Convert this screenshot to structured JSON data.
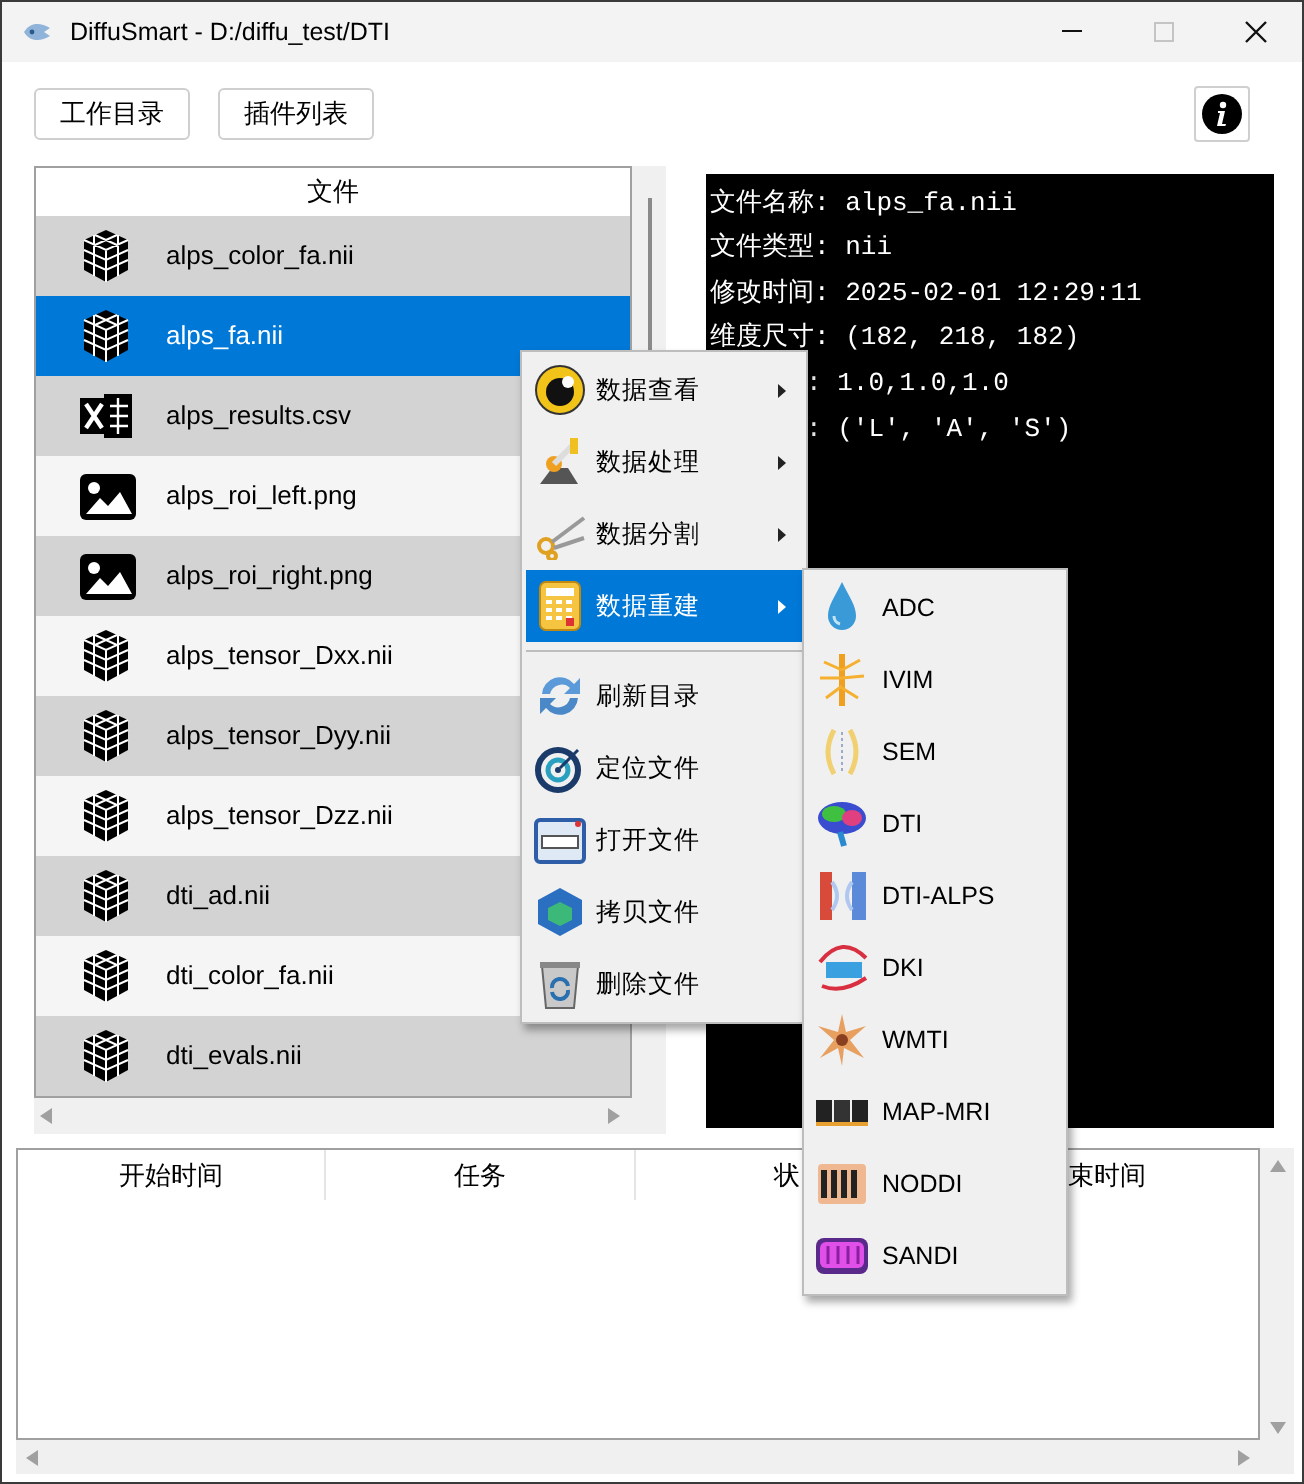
{
  "window": {
    "title": "DiffuSmart - D:/diffu_test/DTI",
    "controls": [
      {
        "kind": "minimize",
        "disabled": false
      },
      {
        "kind": "maximize",
        "disabled": true
      },
      {
        "kind": "close",
        "disabled": false
      }
    ]
  },
  "toolbar": {
    "buttons": [
      "工作目录",
      "插件列表"
    ]
  },
  "file_list": {
    "header": "文件",
    "rows": [
      {
        "name": "alps_color_fa.nii",
        "kind": "volume",
        "selected": false
      },
      {
        "name": "alps_fa.nii",
        "kind": "volume",
        "selected": true
      },
      {
        "name": "alps_results.csv",
        "kind": "spreadsheet",
        "selected": false
      },
      {
        "name": "alps_roi_left.png",
        "kind": "image",
        "selected": false
      },
      {
        "name": "alps_roi_right.png",
        "kind": "image",
        "selected": false
      },
      {
        "name": "alps_tensor_Dxx.nii",
        "kind": "volume",
        "selected": false
      },
      {
        "name": "alps_tensor_Dyy.nii",
        "kind": "volume",
        "selected": false
      },
      {
        "name": "alps_tensor_Dzz.nii",
        "kind": "volume",
        "selected": false
      },
      {
        "name": "dti_ad.nii",
        "kind": "volume",
        "selected": false
      },
      {
        "name": "dti_color_fa.nii",
        "kind": "volume",
        "selected": false
      },
      {
        "name": "dti_evals.nii",
        "kind": "volume",
        "selected": false
      }
    ]
  },
  "file_info": {
    "lines": [
      {
        "text": "文件名称: alps_fa.nii",
        "kind": "full"
      },
      {
        "text": "文件类型: nii",
        "kind": "full"
      },
      {
        "text": "修改时间: 2025-02-01 12:29:11",
        "kind": "full"
      },
      {
        "text": "维度尺寸: (182, 218, 182)",
        "kind": "full"
      },
      {
        "text": ": 1.0,1.0,1.0",
        "kind": "covered"
      },
      {
        "text": ": ('L', 'A', 'S')",
        "kind": "covered"
      }
    ]
  },
  "task_table": {
    "columns": [
      "开始时间",
      "任务",
      "状",
      "束时间"
    ]
  },
  "context_menu": {
    "items": [
      {
        "kind": "item",
        "label": "数据查看",
        "submenu": true,
        "selected": false
      },
      {
        "kind": "item",
        "label": "数据处理",
        "submenu": true,
        "selected": false
      },
      {
        "kind": "item",
        "label": "数据分割",
        "submenu": true,
        "selected": false
      },
      {
        "kind": "item",
        "label": "数据重建",
        "submenu": true,
        "selected": true
      },
      {
        "kind": "separator"
      },
      {
        "kind": "item",
        "label": "刷新目录",
        "submenu": false,
        "selected": false
      },
      {
        "kind": "item",
        "label": "定位文件",
        "submenu": false,
        "selected": false
      },
      {
        "kind": "item",
        "label": "打开文件",
        "submenu": false,
        "selected": false
      },
      {
        "kind": "item",
        "label": "拷贝文件",
        "submenu": false,
        "selected": false
      },
      {
        "kind": "item",
        "label": "删除文件",
        "submenu": false,
        "selected": false
      }
    ]
  },
  "submenu": {
    "items": [
      "ADC",
      "IVIM",
      "SEM",
      "DTI",
      "DTI-ALPS",
      "DKI",
      "WMTI",
      "MAP-MRI",
      "NODDI",
      "SANDI"
    ]
  }
}
